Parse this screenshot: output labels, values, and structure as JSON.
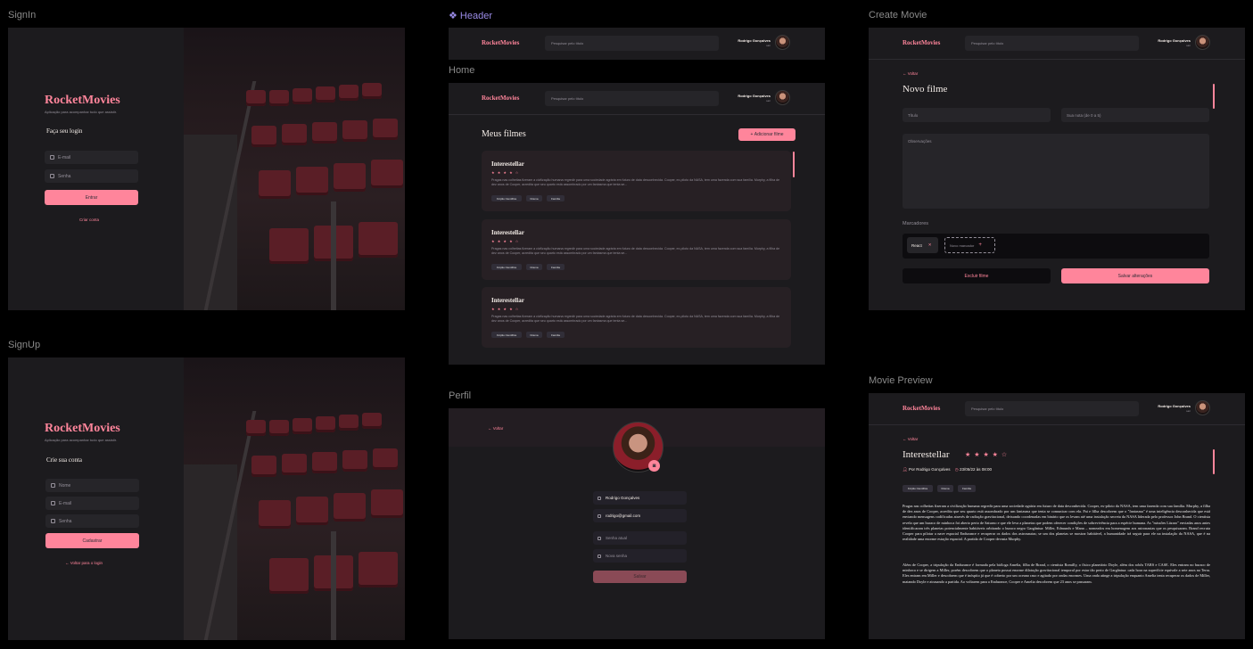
{
  "labels": {
    "signin": "SignIn",
    "signup": "SignUp",
    "header": "Header",
    "home": "Home",
    "perfil": "Perfil",
    "create_movie": "Create Movie",
    "movie_preview": "Movie Preview"
  },
  "app": {
    "brand": "RocketMovies",
    "tagline": "Aplicação para acompanhar tudo que assistir."
  },
  "signin": {
    "title": "Faça seu login",
    "email_placeholder": "E-mail",
    "password_placeholder": "Senha",
    "submit": "Entrar",
    "link": "Criar conta"
  },
  "signup": {
    "title": "Crie sua conta",
    "name_placeholder": "Nome",
    "email_placeholder": "E-mail",
    "password_placeholder": "Senha",
    "submit": "Cadastrar",
    "link": "Voltar para o login"
  },
  "header": {
    "search_placeholder": "Pesquisar pelo título",
    "user_name": "Rodrigo Gonçalves",
    "user_action": "sair"
  },
  "home": {
    "title": "Meus filmes",
    "add_button": "Adicionar filme",
    "cards": [
      {
        "title": "Interestellar",
        "stars": "★ ★ ★ ★ ☆",
        "text": "Pragas nas colheitas fizeram a civilização humana regredir para uma sociedade agrária em futuro de data desconhecida. Cooper, ex-piloto da NASA, tem uma fazenda com sua família. Murphy, a filha de dez anos de Cooper, acredita que seu quarto está assombrado por um fantasma que tenta se...",
        "tags": [
          "Ficção Científica",
          "Drama",
          "Família"
        ]
      },
      {
        "title": "Interestellar",
        "stars": "★ ★ ★ ★ ☆",
        "text": "Pragas nas colheitas fizeram a civilização humana regredir para uma sociedade agrária em futuro de data desconhecida. Cooper, ex-piloto da NASA, tem uma fazenda com sua família. Murphy, a filha de dez anos de Cooper, acredita que seu quarto está assombrado por um fantasma que tenta se...",
        "tags": [
          "Ficção Científica",
          "Drama",
          "Família"
        ]
      },
      {
        "title": "Interestellar",
        "stars": "★ ★ ★ ★ ☆",
        "text": "Pragas nas colheitas fizeram a civilização humana regredir para uma sociedade agrária em futuro de data desconhecida. Cooper, ex-piloto da NASA, tem uma fazenda com sua família. Murphy, a filha de dez anos de Cooper, acredita que seu quarto está assombrado por um fantasma que tenta se...",
        "tags": [
          "Ficção Científica",
          "Drama",
          "Família"
        ]
      }
    ]
  },
  "perfil": {
    "back": "Voltar",
    "name": "Rodrigo Gonçalves",
    "email": "rodrigo@gmail.com",
    "current_password": "Senha atual",
    "new_password": "Nova senha",
    "submit": "Salvar"
  },
  "create": {
    "back": "Voltar",
    "title": "Novo filme",
    "title_placeholder": "Título",
    "rating_placeholder": "Sua nota (de 0 a 5)",
    "notes_placeholder": "Observações",
    "markers_label": "Marcadores",
    "marker_existing": "React",
    "marker_new": "Novo marcador",
    "delete": "Excluir filme",
    "save": "Salvar alterações"
  },
  "preview": {
    "back": "Voltar",
    "title": "Interestellar",
    "stars": "★ ★ ★ ★ ☆",
    "author": "Por Rodrigo Gonçalves",
    "date": "23/05/22 às 08:00",
    "tags": [
      "Ficção Científica",
      "Drama",
      "Família"
    ],
    "paragraph1": "Pragas nas colheitas fizeram a civilização humana regredir para uma sociedade agrária em futuro de data desconhecida. Cooper, ex-piloto da NASA, tem uma fazenda com sua família. Murphy, a filha de dez anos de Cooper, acredita que seu quarto está assombrado por um fantasma que tenta se comunicar com ela. Pai e filha descobrem que o \"fantasma\" é uma inteligência desconhecida que está enviando mensagens codificadas através de radiação gravitacional, deixando coordenadas em binário que os levam até uma instalação secreta da NASA liderada pelo professor John Brand. O cientista revela que um buraco de minhoca foi aberto perto de Saturno e que ele leva a planetas que podem oferecer condições de sobrevivência para a espécie humana. As \"missões Lázaro\" enviadas anos antes identificaram três planetas potencialmente habitáveis orbitando o buraco negro Gargântua: Miller, Edmunds e Mann – nomeados em homenagem aos astronautas que os pesquisaram. Brand recruta Cooper para pilotar a nave espacial Endurance e recuperar os dados dos astronautas; se um dos planetas se mostrar habitável, a humanidade irá seguir para ele na instalação da NASA, que é na realidade uma enorme estação espacial. A partida de Cooper devasta Murphy.",
    "paragraph2": "Além de Cooper, a tripulação da Endurance é formada pela bióloga Amelia, filha de Brand, o cientista Romilly, o físico planetário Doyle, além dos robôs TARS e CASE. Eles entram no buraco de minhoca e se dirigem a Miller, porém descobrem que o planeta possui enorme dilatação gravitacional temporal por estar tão perto de Gargântua: cada hora na superfície equivale a sete anos na Terra. Eles entram em Miller e descobrem que é inóspito já que é coberto por um oceano raso e agitado por ondas enormes. Uma onda atinge a tripulação enquanto Amelia tenta recuperar os dados de Miller, matando Doyle e atrasando a partida. Ao voltarem para a Endurance, Cooper e Amelia descobrem que 23 anos se passaram."
  },
  "colors": {
    "accent": "#FF859B",
    "background": "#1C1B1E",
    "input": "#262529",
    "muted_text": "#948F99"
  }
}
